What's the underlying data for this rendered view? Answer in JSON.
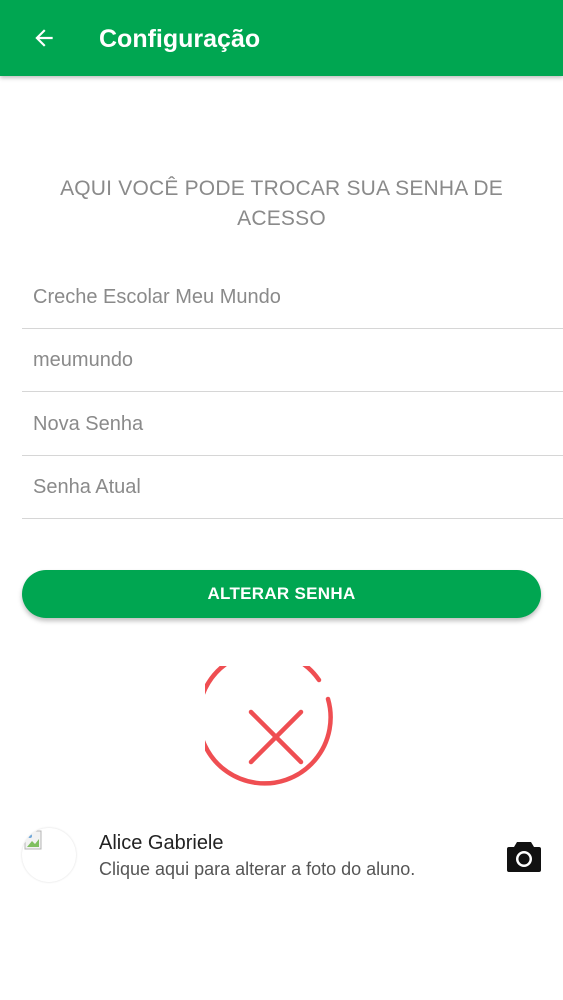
{
  "app_bar": {
    "title": "Configuração",
    "back_icon": "arrow-left-icon",
    "background_color": "#00a651"
  },
  "form": {
    "info_text": "AQUI VOCÊ PODE TROCAR SUA SENHA DE ACESSO",
    "fields": [
      {
        "value": "Creche Escolar Meu Mundo",
        "placeholder": ""
      },
      {
        "value": "meumundo",
        "placeholder": ""
      },
      {
        "value": "",
        "placeholder": "Nova Senha"
      },
      {
        "value": "",
        "placeholder": "Senha Atual"
      }
    ],
    "submit_label": "ALTERAR SENHA"
  },
  "status": {
    "icon": "error-x-circle-icon",
    "color": "#ef4e52"
  },
  "student": {
    "name": "Alice Gabriele",
    "hint": "Clique aqui para alterar a foto do aluno.",
    "avatar_icon": "broken-image-icon",
    "camera_icon": "camera-icon"
  }
}
